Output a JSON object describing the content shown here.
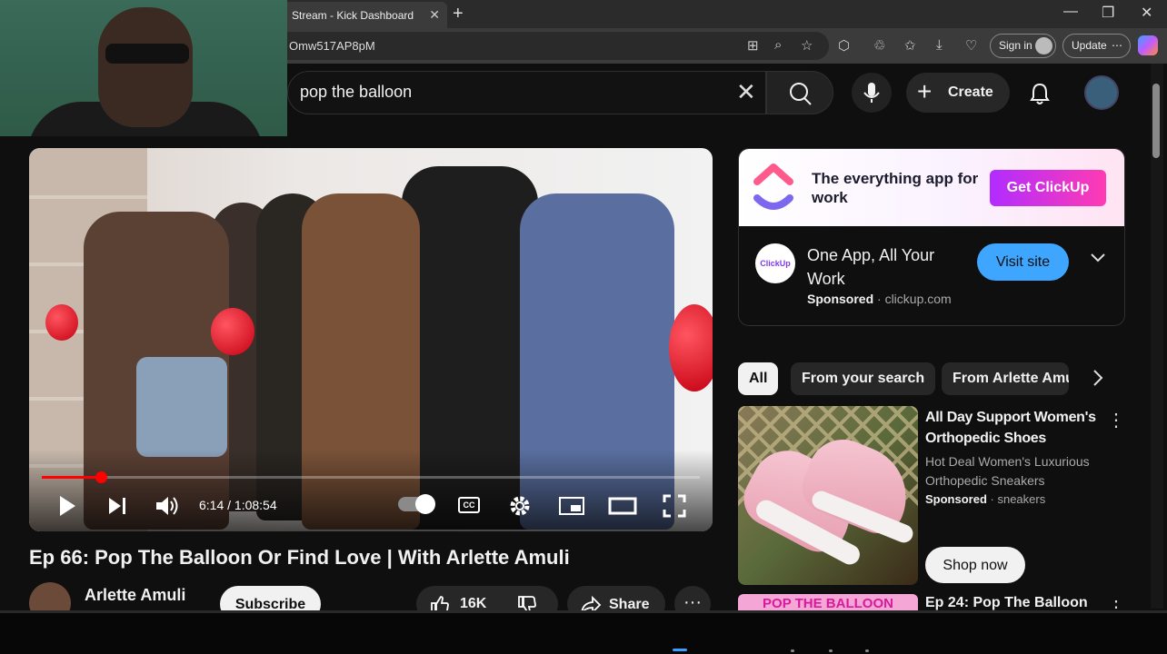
{
  "browser": {
    "tab_title": "Stream - Kick Dashboard",
    "url": "Omw517AP8pM",
    "signin_label": "Sign in",
    "update_label": "Update"
  },
  "masthead": {
    "search_value": "pop the balloon",
    "create_label": "Create"
  },
  "player": {
    "time": "6:14 / 1:08:54",
    "progress_fraction": 0.09,
    "cc_label": "CC"
  },
  "video": {
    "title": "Ep 66: Pop The Balloon Or Find Love | With Arlette Amuli",
    "channel": "Arlette Amuli",
    "subscribe_label": "Subscribe",
    "likes": "16K",
    "share_label": "Share",
    "more_label": "···"
  },
  "ad": {
    "tagline": "The everything app for work",
    "cta": "Get ClickUp",
    "icon_text": "ClickUp",
    "title": "One App, All Your Work",
    "sponsored": "Sponsored",
    "domain": "· clickup.com",
    "visit_label": "Visit site"
  },
  "chips": [
    "All",
    "From your search",
    "From Arlette Amuli"
  ],
  "product": {
    "title": "All Day Support Women's Orthopedic Shoes",
    "desc": "Hot Deal Women's Luxurious Orthopedic Sneakers",
    "sponsored": "Sponsored",
    "source": "· sneakers",
    "cta": "Shop now"
  },
  "next": {
    "thumb_text": "POP THE BALLOON",
    "title": "Ep 24: Pop The Balloon"
  },
  "colors": {
    "accent_red": "#ff0000",
    "visit_blue": "#3ea6ff",
    "clickup_gradient_start": "#b12cff",
    "clickup_gradient_end": "#ff3bb3"
  }
}
